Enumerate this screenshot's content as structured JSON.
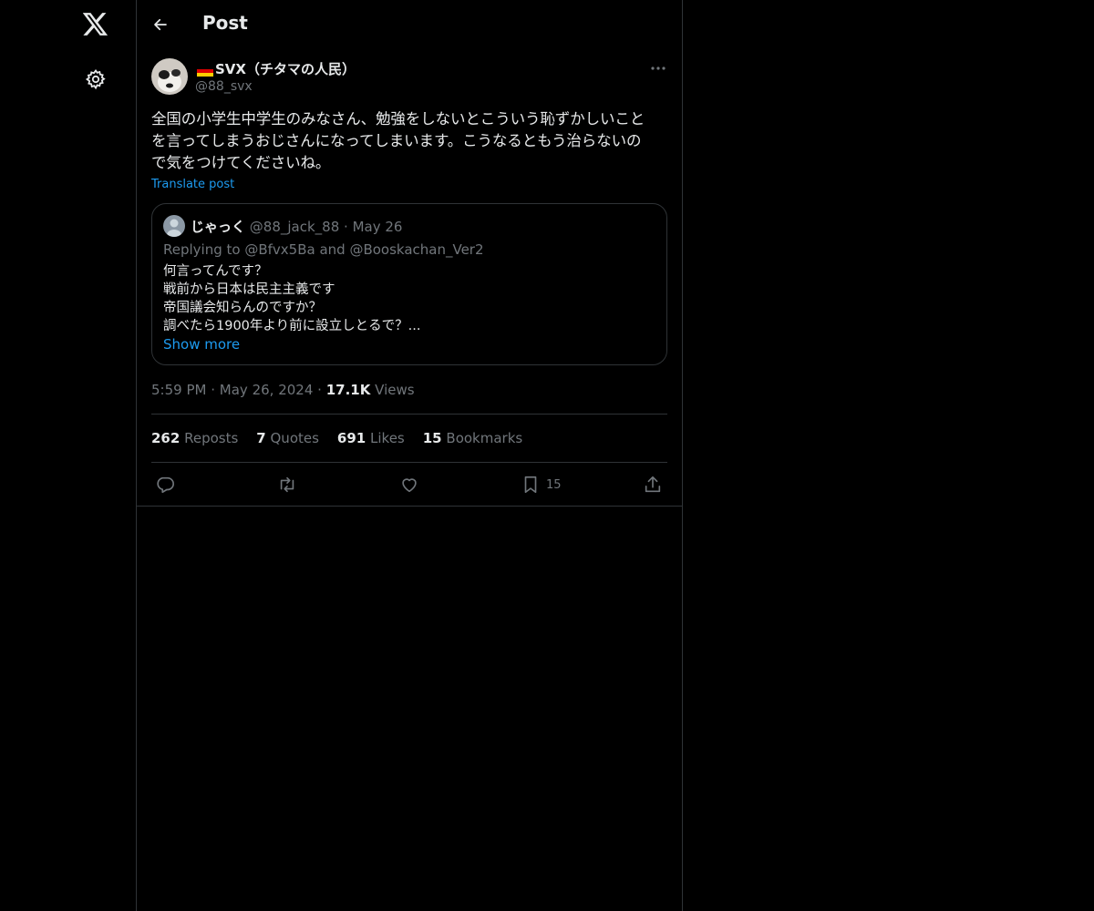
{
  "nav": {
    "logo_icon": "x-logo-icon",
    "settings_icon": "gear-icon"
  },
  "header": {
    "title": "Post",
    "back_icon": "arrow-left-icon"
  },
  "post": {
    "display_name": "SVX（チタマの人民）",
    "flag": "germany-flag",
    "handle": "@88_svx",
    "text": "全国の小学生中学生のみなさん、勉強をしないとこういう恥ずかしいこと\nを言ってしまうおじさんになってしまいます。こうなるともう治らないの\nで気をつけてくださいね。",
    "translate_label": "Translate post",
    "time": "5:59 PM",
    "date": "May 26, 2024",
    "views_count": "17.1K",
    "views_label": "Views",
    "separator": "·"
  },
  "quote": {
    "name": "じゃっく",
    "handle": "@88_jack_88",
    "separator": "·",
    "date": "May 26",
    "replying": "Replying to @Bfvx5Ba and @Booskachan_Ver2",
    "text": "何言ってんです？\n戦前から日本は民主主義です\n帝国議会知らんのですか？\n調べたら1900年より前に設立しとるで？...",
    "show_more": "Show more"
  },
  "stats": {
    "reposts_count": "262",
    "reposts_label": "Reposts",
    "quotes_count": "7",
    "quotes_label": "Quotes",
    "likes_count": "691",
    "likes_label": "Likes",
    "bookmarks_count": "15",
    "bookmarks_label": "Bookmarks"
  },
  "actions": {
    "bookmark_count": "15"
  },
  "colors": {
    "background": "#000000",
    "text": "#e7e9ea",
    "muted": "#71767b",
    "link": "#1d9bf0",
    "border": "#2f3336"
  }
}
